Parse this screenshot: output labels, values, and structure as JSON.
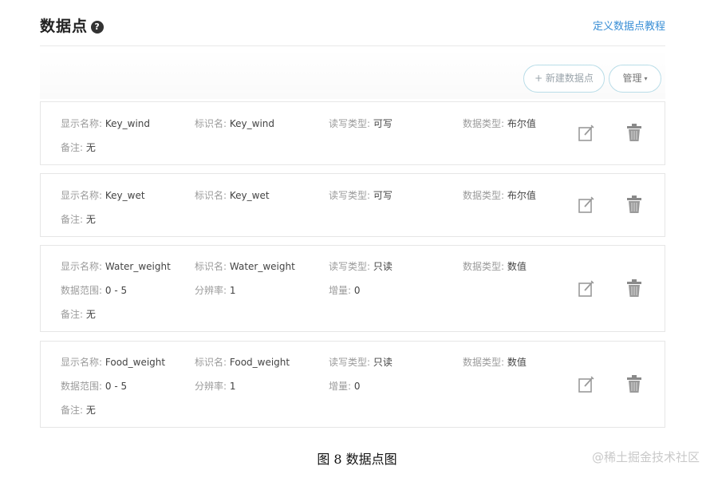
{
  "header": {
    "title": "数据点",
    "help_glyph": "?",
    "tutorial_link": "定义数据点教程"
  },
  "toolbar": {
    "new_button": "+ 新建数据点",
    "manage_button": "管理",
    "manage_caret": "▾"
  },
  "labels": {
    "display_name": "显示名称:",
    "identifier": "标识名:",
    "rw_type": "读写类型:",
    "data_type": "数据类型:",
    "note": "备注:",
    "range": "数据范围:",
    "resolution": "分辨率:",
    "increment": "增量:"
  },
  "datapoints": [
    {
      "display_name": "Key_wind",
      "identifier": "Key_wind",
      "rw_type": "可写",
      "data_type": "布尔值",
      "note": "无"
    },
    {
      "display_name": "Key_wet",
      "identifier": "Key_wet",
      "rw_type": "可写",
      "data_type": "布尔值",
      "note": "无"
    },
    {
      "display_name": "Water_weight",
      "identifier": "Water_weight",
      "rw_type": "只读",
      "data_type": "数值",
      "range": "0 - 5",
      "resolution": "1",
      "increment": "0",
      "note": "无"
    },
    {
      "display_name": "Food_weight",
      "identifier": "Food_weight",
      "rw_type": "只读",
      "data_type": "数值",
      "range": "0 - 5",
      "resolution": "1",
      "increment": "0",
      "note": "无"
    }
  ],
  "caption": "图 8  数据点图",
  "watermark": "@稀土掘金技术社区"
}
